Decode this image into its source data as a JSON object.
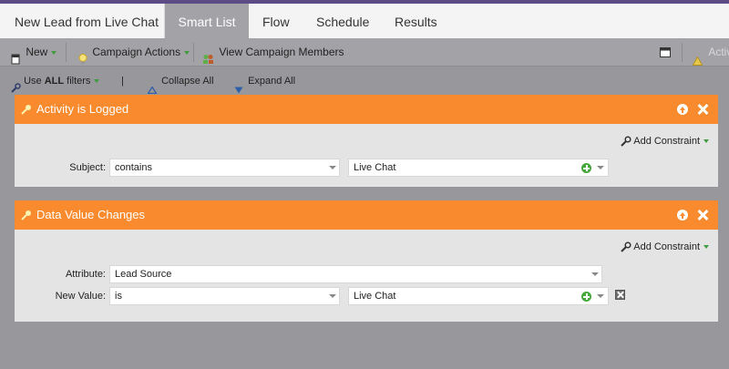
{
  "tabs": [
    {
      "label": "New Lead from Live Chat"
    },
    {
      "label": "Smart List"
    },
    {
      "label": "Flow"
    },
    {
      "label": "Schedule"
    },
    {
      "label": "Results"
    }
  ],
  "toolbar": {
    "new_label": "New",
    "campaign_actions_label": "Campaign Actions",
    "view_members_label": "View Campaign Members",
    "status_label": "Active"
  },
  "filterbar": {
    "use_prefix": "Use ",
    "use_all": "ALL",
    "use_suffix": " filters",
    "pipe": "|",
    "collapse_label": "Collapse All",
    "expand_label": "Expand All"
  },
  "filters": [
    {
      "title": "Activity is Logged",
      "add_constraint": "Add Constraint",
      "rows": [
        {
          "label": "Subject:",
          "operator": "contains",
          "value": "Live Chat"
        }
      ]
    },
    {
      "title": "Data Value Changes",
      "add_constraint": "Add Constraint",
      "attribute_label": "Attribute:",
      "attribute_value": "Lead Source",
      "rows": [
        {
          "label": "New Value:",
          "operator": "is",
          "value": "Live Chat"
        }
      ]
    }
  ],
  "colors": {
    "accent": "#f98a2e",
    "tab_active": "#a3a2a6",
    "background": "#98979b",
    "brand_line": "#5c4c86"
  }
}
